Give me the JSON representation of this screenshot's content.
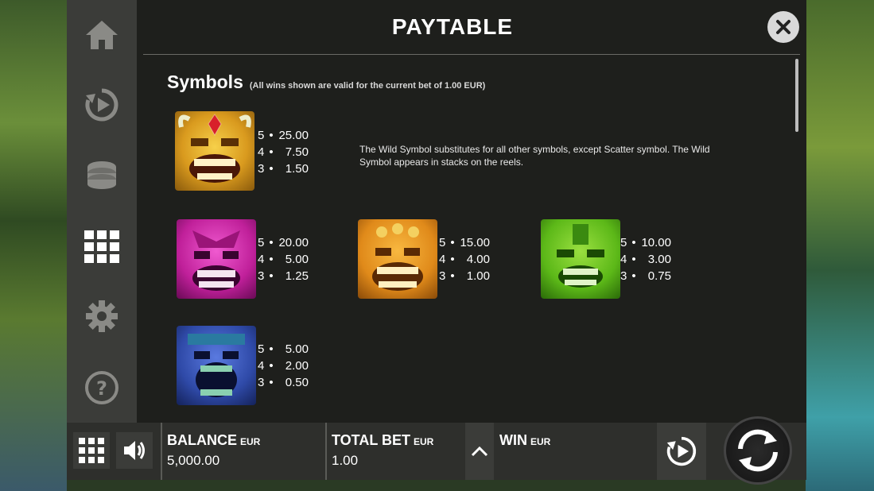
{
  "title": "PAYTABLE",
  "symbols_heading": "Symbols",
  "symbols_note": "(All wins shown are valid for the current bet of 1.00 EUR)",
  "wild_description": "The Wild Symbol substitutes for all other symbols, except Scatter symbol. The Wild Symbol appears in stacks on the reels.",
  "symbols": [
    {
      "name": "wild-tiki",
      "color": "#e0a020",
      "pays": [
        {
          "n": "5",
          "v": "25.00"
        },
        {
          "n": "4",
          "v": "7.50"
        },
        {
          "n": "3",
          "v": "1.50"
        }
      ]
    },
    {
      "name": "pink-tiki",
      "color": "#d02aa8",
      "pays": [
        {
          "n": "5",
          "v": "20.00"
        },
        {
          "n": "4",
          "v": "5.00"
        },
        {
          "n": "3",
          "v": "1.25"
        }
      ]
    },
    {
      "name": "orange-tiki",
      "color": "#e89020",
      "pays": [
        {
          "n": "5",
          "v": "15.00"
        },
        {
          "n": "4",
          "v": "4.00"
        },
        {
          "n": "3",
          "v": "1.00"
        }
      ]
    },
    {
      "name": "green-tiki",
      "color": "#6cc820",
      "pays": [
        {
          "n": "5",
          "v": "10.00"
        },
        {
          "n": "4",
          "v": "3.00"
        },
        {
          "n": "3",
          "v": "0.75"
        }
      ]
    },
    {
      "name": "blue-tiki",
      "color": "#3a5ab8",
      "pays": [
        {
          "n": "5",
          "v": "5.00"
        },
        {
          "n": "4",
          "v": "2.00"
        },
        {
          "n": "3",
          "v": "0.50"
        }
      ]
    }
  ],
  "bottom_bar": {
    "balance_label": "BALANCE",
    "balance_currency": "EUR",
    "balance_value": "5,000.00",
    "total_bet_label": "TOTAL BET",
    "total_bet_currency": "EUR",
    "total_bet_value": "1.00",
    "win_label": "WIN",
    "win_currency": "EUR"
  },
  "colors": {
    "panel": "#1e1f1c",
    "sidebar": "#3b3c39",
    "icon": "#8a8a86",
    "active_icon": "#ffffff"
  },
  "sidebar_icons": [
    "home-icon",
    "autoplay-icon",
    "coin-stack-icon",
    "paytable-grid-icon",
    "gear-icon",
    "help-icon"
  ]
}
